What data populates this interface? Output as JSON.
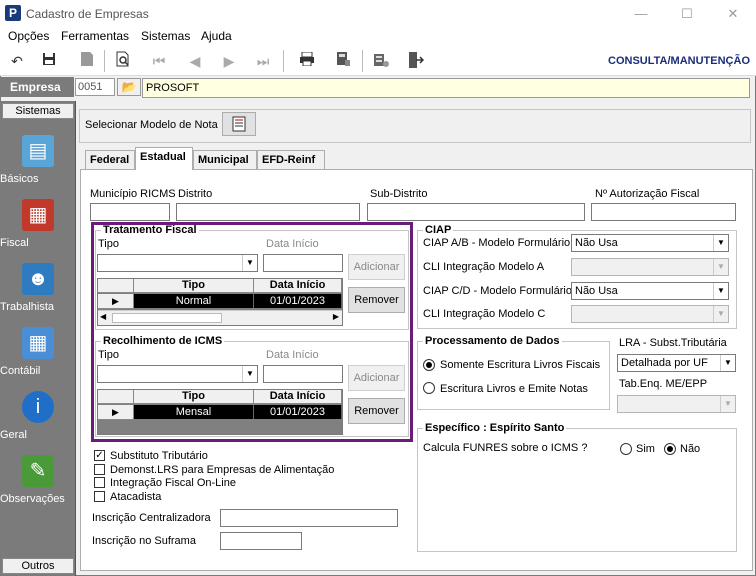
{
  "window": {
    "title": "Cadastro de Empresas",
    "app_icon": "P",
    "controls": [
      "—",
      "☐",
      "✕"
    ]
  },
  "menu": [
    "Opções",
    "Ferramentas",
    "Sistemas",
    "Ajuda"
  ],
  "toolbar": {
    "mode_label": "CONSULTA/MANUTENÇÃO"
  },
  "empresa": {
    "label": "Empresa",
    "code": "0051",
    "name": "PROSOFT"
  },
  "sidebar": {
    "header": "Sistemas",
    "footer": "Outros",
    "items": [
      {
        "label": "Básicos",
        "icon": "books-icon",
        "color": "#5aa5d8"
      },
      {
        "label": "Fiscal",
        "icon": "calculator-icon",
        "color": "#c0392b"
      },
      {
        "label": "Trabalhista",
        "icon": "worker-icon",
        "color": "#2e7bbf"
      },
      {
        "label": "Contábil",
        "icon": "calculator-icon",
        "color": "#4a8fd6"
      },
      {
        "label": "Geral",
        "icon": "info-icon",
        "color": "#1f6fc9"
      },
      {
        "label": "Observações",
        "icon": "pencil-note-icon",
        "color": "#4a9a3a"
      }
    ]
  },
  "modelo_nota": {
    "label": "Selecionar Modelo de Nota"
  },
  "tabs": [
    "Federal",
    "Estadual",
    "Municipal",
    "EFD-Reinf"
  ],
  "active_tab": "Estadual",
  "top_fields": {
    "municipio": "Município RICMS",
    "distrito": "Distrito",
    "subdistrito": "Sub-Distrito",
    "autorizacao": "Nº Autorização Fiscal"
  },
  "tratamento": {
    "title": "Tratamento Fiscal",
    "tipo_label": "Tipo",
    "data_label": "Data Início",
    "add": "Adicionar",
    "remove": "Remover",
    "headers": [
      "Tipo",
      "Data Início"
    ],
    "rows": [
      {
        "tipo": "Normal",
        "data": "01/01/2023"
      }
    ]
  },
  "recolhimento": {
    "title": "Recolhimento de ICMS",
    "tipo_label": "Tipo",
    "data_label": "Data Início",
    "add": "Adicionar",
    "remove": "Remover",
    "headers": [
      "Tipo",
      "Data Início"
    ],
    "rows": [
      {
        "tipo": "Mensal",
        "data": "01/01/2023"
      }
    ]
  },
  "ciap": {
    "title": "CIAP",
    "ab_label": "CIAP  A/B - Modelo Formulário",
    "ab_value": "Não Usa",
    "cli_a_label": "CLI Integração Modelo A",
    "cd_label": "CIAP C/D - Modelo Formulário",
    "cd_value": "Não Usa",
    "cli_c_label": "CLI Integração Modelo C"
  },
  "processamento": {
    "title": "Processamento de Dados",
    "opt1": "Somente Escritura Livros Fiscais",
    "opt2": "Escritura Livros e Emite Notas"
  },
  "lra": {
    "label": "LRA - Subst.Tributária",
    "value": "Detalhada por UF",
    "tab_label": "Tab.Enq. ME/EPP"
  },
  "checkboxes": [
    {
      "label": "Substituto Tributário",
      "checked": true
    },
    {
      "label": "Demonst.LRS para Empresas de Alimentação",
      "checked": false
    },
    {
      "label": "Integração Fiscal On-Line",
      "checked": false
    },
    {
      "label": "Atacadista",
      "checked": false
    }
  ],
  "inscricao": {
    "centralizadora": "Inscrição Centralizadora",
    "suframa": "Inscrição no Suframa"
  },
  "espirito_santo": {
    "title": "Específico : Espírito Santo",
    "question": "Calcula FUNRES sobre o ICMS ?",
    "sim": "Sim",
    "nao": "Não"
  }
}
